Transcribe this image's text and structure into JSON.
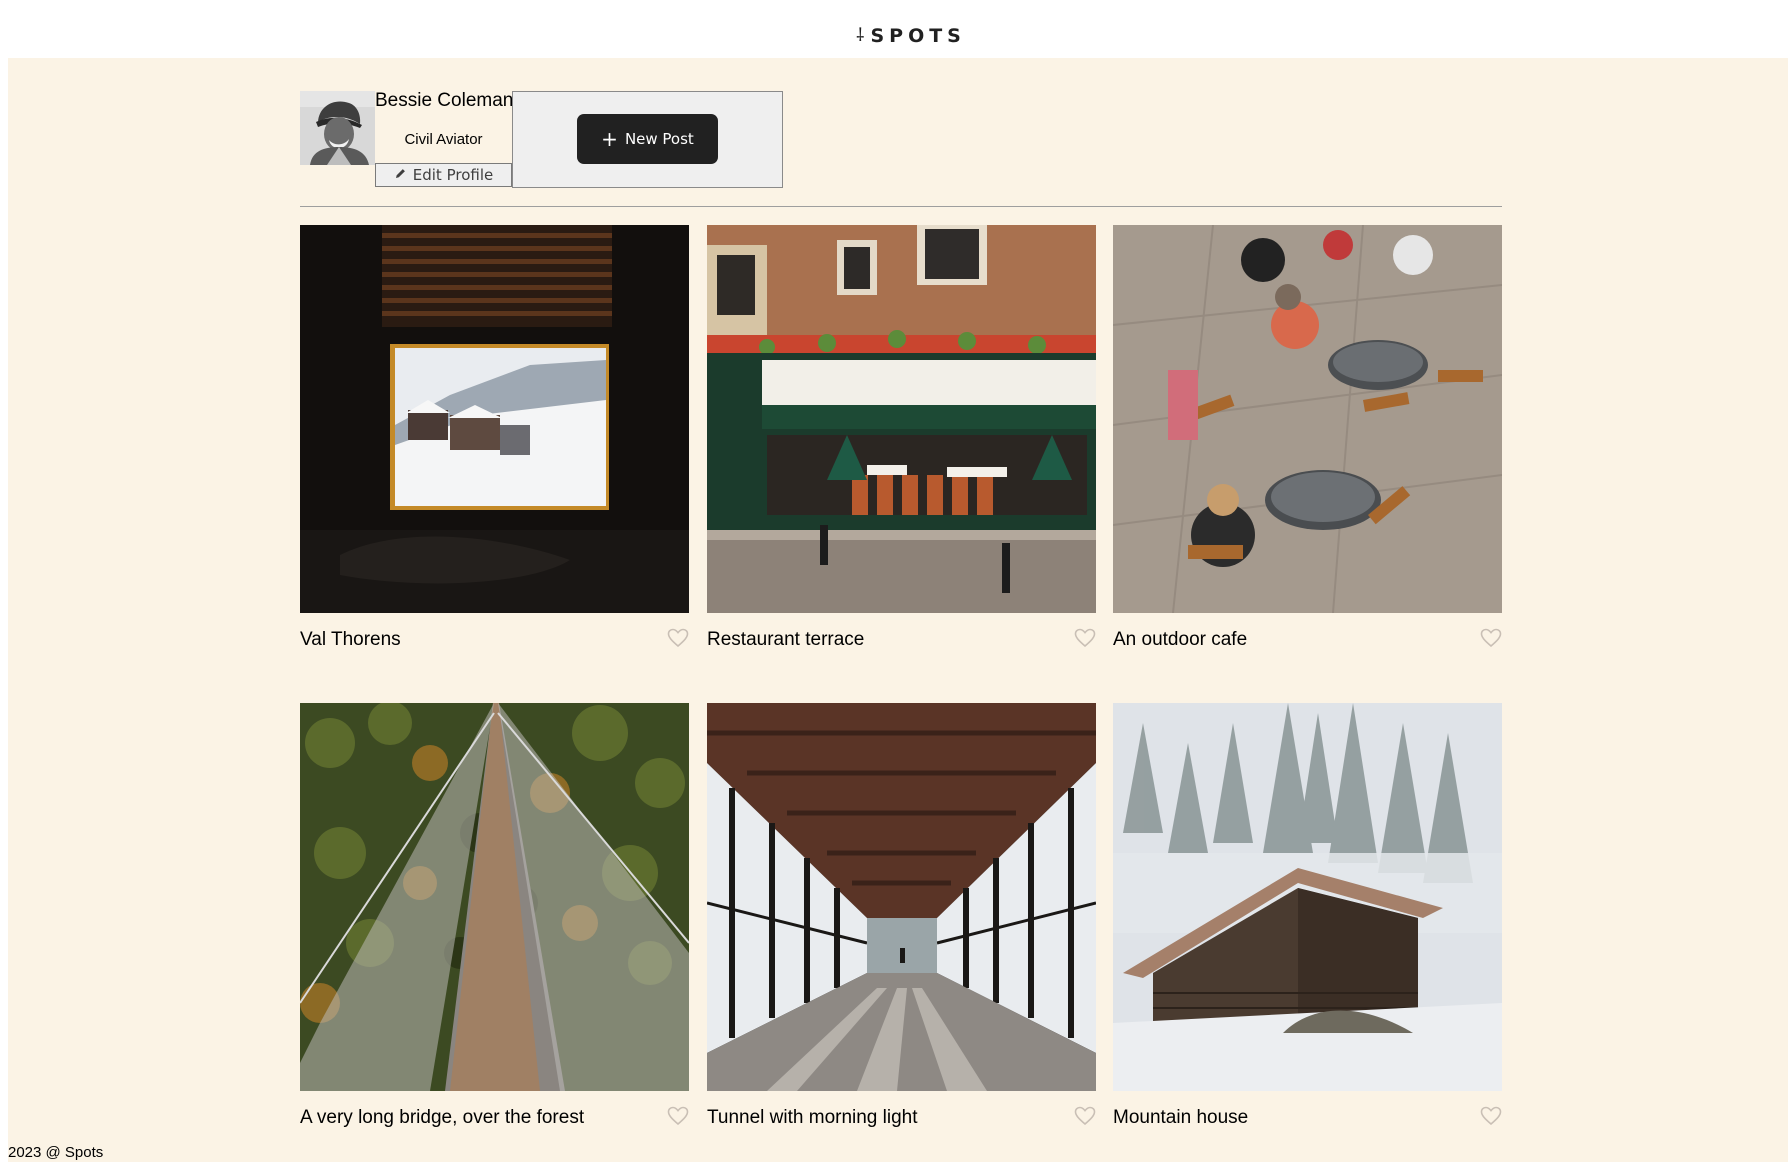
{
  "app": {
    "logo_text": "SPOTS"
  },
  "profile": {
    "name": "Bessie Coleman",
    "job": "Civil Aviator",
    "edit_label": "Edit Profile",
    "new_post_label": "New Post"
  },
  "cards": [
    {
      "title": "Val Thorens",
      "liked": false
    },
    {
      "title": "Restaurant terrace",
      "liked": false
    },
    {
      "title": "An outdoor cafe",
      "liked": false
    },
    {
      "title": "A very long bridge, over the forest",
      "liked": false
    },
    {
      "title": "Tunnel with morning light",
      "liked": false
    },
    {
      "title": "Mountain house",
      "liked": false
    }
  ],
  "footer": {
    "text": "2023 @ Spots"
  },
  "icons": {
    "logo": "pin-icon",
    "edit": "pencil-icon",
    "new_post": "plus-icon",
    "like": "heart-icon"
  },
  "colors": {
    "page_background": "#fbf3e5",
    "button_dark": "#212121",
    "heart_outline": "#c9bfb5"
  }
}
